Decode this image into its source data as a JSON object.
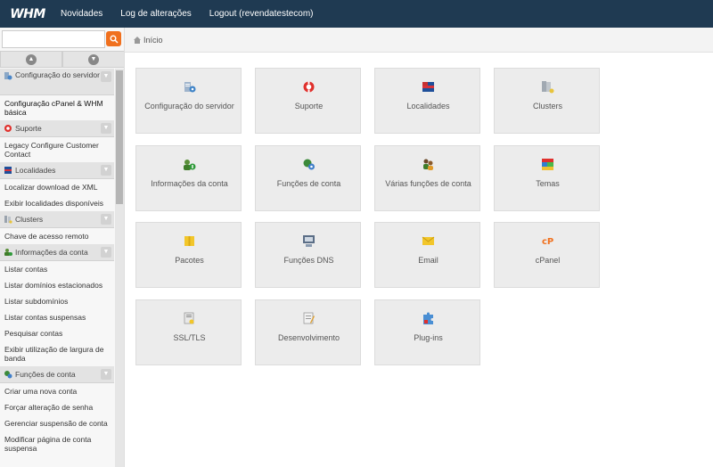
{
  "header": {
    "logo": "WHM",
    "nav": [
      "Novidades",
      "Log de alterações",
      "Logout (revendatestecom)"
    ]
  },
  "search": {
    "value": "",
    "placeholder": ""
  },
  "breadcrumb": "Início",
  "sidebar": {
    "sections": [
      {
        "title": "Configuração do servidor",
        "icon": "server-config-icon",
        "items": [
          "Configuração cPanel & WHM básica"
        ]
      },
      {
        "title": "Suporte",
        "icon": "lifebuoy-icon",
        "items": [
          "Legacy Configure Customer Contact"
        ]
      },
      {
        "title": "Localidades",
        "icon": "flag-icon",
        "items": [
          "Localizar download de XML",
          "Exibir localidades disponíveis"
        ]
      },
      {
        "title": "Clusters",
        "icon": "cluster-icon",
        "items": [
          "Chave de acesso remoto"
        ]
      },
      {
        "title": "Informações da conta",
        "icon": "account-info-icon",
        "items": [
          "Listar contas",
          "Listar domínios estacionados",
          "Listar subdomínios",
          "Listar contas suspensas",
          "Pesquisar contas",
          "Exibir utilização de largura de banda"
        ]
      },
      {
        "title": "Funções de conta",
        "icon": "account-functions-icon",
        "items": [
          "Criar uma nova conta",
          "Forçar alteração de senha",
          "Gerenciar suspensão de conta",
          "Modificar página de conta suspensa"
        ]
      }
    ]
  },
  "tiles": [
    {
      "label": "Configuração do servidor",
      "icon": "server-config-icon"
    },
    {
      "label": "Suporte",
      "icon": "lifebuoy-icon"
    },
    {
      "label": "Localidades",
      "icon": "flag-icon"
    },
    {
      "label": "Clusters",
      "icon": "cluster-icon"
    },
    {
      "label": "Informações da conta",
      "icon": "account-info-icon"
    },
    {
      "label": "Funções de conta",
      "icon": "account-functions-icon"
    },
    {
      "label": "Várias funções de conta",
      "icon": "multi-account-icon"
    },
    {
      "label": "Temas",
      "icon": "themes-icon"
    },
    {
      "label": "Pacotes",
      "icon": "package-icon"
    },
    {
      "label": "Funções DNS",
      "icon": "dns-icon"
    },
    {
      "label": "Email",
      "icon": "email-icon"
    },
    {
      "label": "cPanel",
      "icon": "cpanel-icon"
    },
    {
      "label": "SSL/TLS",
      "icon": "ssl-icon"
    },
    {
      "label": "Desenvolvimento",
      "icon": "development-icon"
    },
    {
      "label": "Plug-ins",
      "icon": "plugin-icon"
    }
  ]
}
